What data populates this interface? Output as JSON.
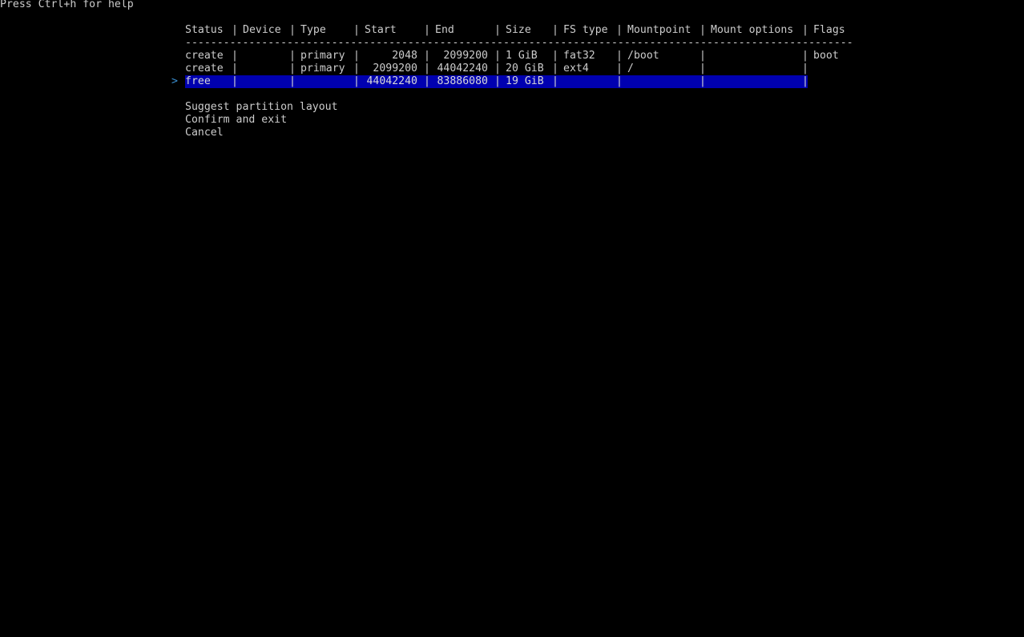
{
  "help_text": "Press Ctrl+h for help",
  "columns": [
    "Status",
    "Device",
    "Type",
    "Start",
    "End",
    "Size",
    "FS type",
    "Mountpoint",
    "Mount options",
    "Flags"
  ],
  "separator": "|",
  "divider": "--------------------------------------------------------------------------------------------------------------------------------",
  "selection_pointer": ">",
  "rows": [
    {
      "status": "create",
      "device": "",
      "type": "primary",
      "start": "2048",
      "end": "2099200",
      "size": "1 GiB",
      "fs_type": "fat32",
      "mountpoint": "/boot",
      "mount_options": "",
      "flags": "boot"
    },
    {
      "status": "create",
      "device": "",
      "type": "primary",
      "start": "2099200",
      "end": "44042240",
      "size": "20 GiB",
      "fs_type": "ext4",
      "mountpoint": "/",
      "mount_options": "",
      "flags": ""
    },
    {
      "status": "free",
      "device": "",
      "type": "",
      "start": "44042240",
      "end": "83886080",
      "size": "19 GiB",
      "fs_type": "",
      "mountpoint": "",
      "mount_options": "",
      "flags": ""
    }
  ],
  "selected_row": 2,
  "menu": {
    "suggest": "Suggest partition layout",
    "confirm": "Confirm and exit",
    "cancel": "Cancel"
  },
  "colors": {
    "background": "#000000",
    "text": "#cccccc",
    "highlight_bg": "#0000b0",
    "highlight_text": "#d8d8d8",
    "pointer": "#3a8fd0"
  }
}
